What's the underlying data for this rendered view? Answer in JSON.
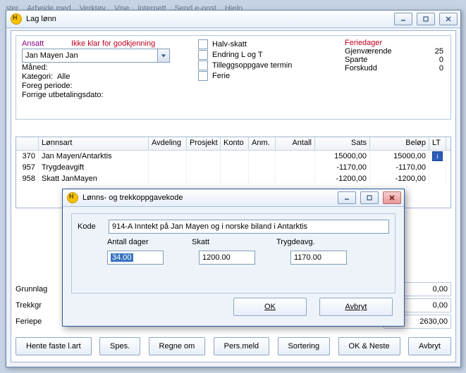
{
  "menubar": [
    "ster",
    "Arbeide med",
    "Verktøy",
    "Vise",
    "Internett",
    "Send e-post",
    "Hjelp"
  ],
  "mainWindow": {
    "title": "Lag lønn"
  },
  "ansatt": {
    "label": "Ansatt",
    "status": "Ikke klar for godkjenning",
    "selected": "Jan                     Mayen Jan",
    "maned": "Måned:",
    "kategori_label": "Kategori:",
    "kategori_value": "Alle",
    "foreg": "Foreg periode:",
    "forrige": "Forrige utbetalingsdato:"
  },
  "checks": {
    "halvskatt": "Halv-skatt",
    "endring": "Endring L og T",
    "tillegg": "Tilleggsoppgave termin",
    "ferie": "Ferie"
  },
  "feriedager": {
    "header": "Feriedager",
    "rows": [
      [
        "Gjenværende",
        "25"
      ],
      [
        "Sparte",
        "0"
      ],
      [
        "Forskudd",
        "0"
      ]
    ]
  },
  "grid": {
    "headers": [
      "",
      "Lønnsart",
      "Avdeling",
      "Prosjekt",
      "Konto",
      "Anm.",
      "Antall",
      "Sats",
      "Beløp",
      "LT"
    ],
    "rows": [
      {
        "num": "370",
        "art": "Jan Mayen/Antarktis",
        "sats": "15000,00",
        "belop": "15000,00",
        "lt": "i"
      },
      {
        "num": "957",
        "art": "Trygdeavgift",
        "sats": "-1170,00",
        "belop": "-1170,00",
        "lt": ""
      },
      {
        "num": "958",
        "art": "Skatt JanMayen",
        "sats": "-1200,00",
        "belop": "-1200,00",
        "lt": ""
      }
    ]
  },
  "totals": {
    "labels": [
      "Grunnlag",
      "Trekkgr",
      "Feriepe"
    ],
    "amounts": [
      "0,00",
      "0,00",
      "2630,00"
    ]
  },
  "buttons": {
    "hente": "Hente faste l.art",
    "spes": "Spes.",
    "regne": "Regne om",
    "pers": "Pers.meld",
    "sort": "Sortering",
    "okneste": "OK & Neste",
    "avbryt": "Avbryt"
  },
  "dialog": {
    "title": "Lønns- og trekkoppgavekode",
    "kode_label": "Kode",
    "kode_value": "914-A Inntekt på Jan Mayen og i norske biland i Antarktis",
    "antall_label": "Antall dager",
    "antall_value": "34.00",
    "skatt_label": "Skatt",
    "skatt_value": "1200.00",
    "trygd_label": "Trygdeavg.",
    "trygd_value": "1170.00",
    "ok": "OK",
    "avbryt": "Avbryt"
  }
}
